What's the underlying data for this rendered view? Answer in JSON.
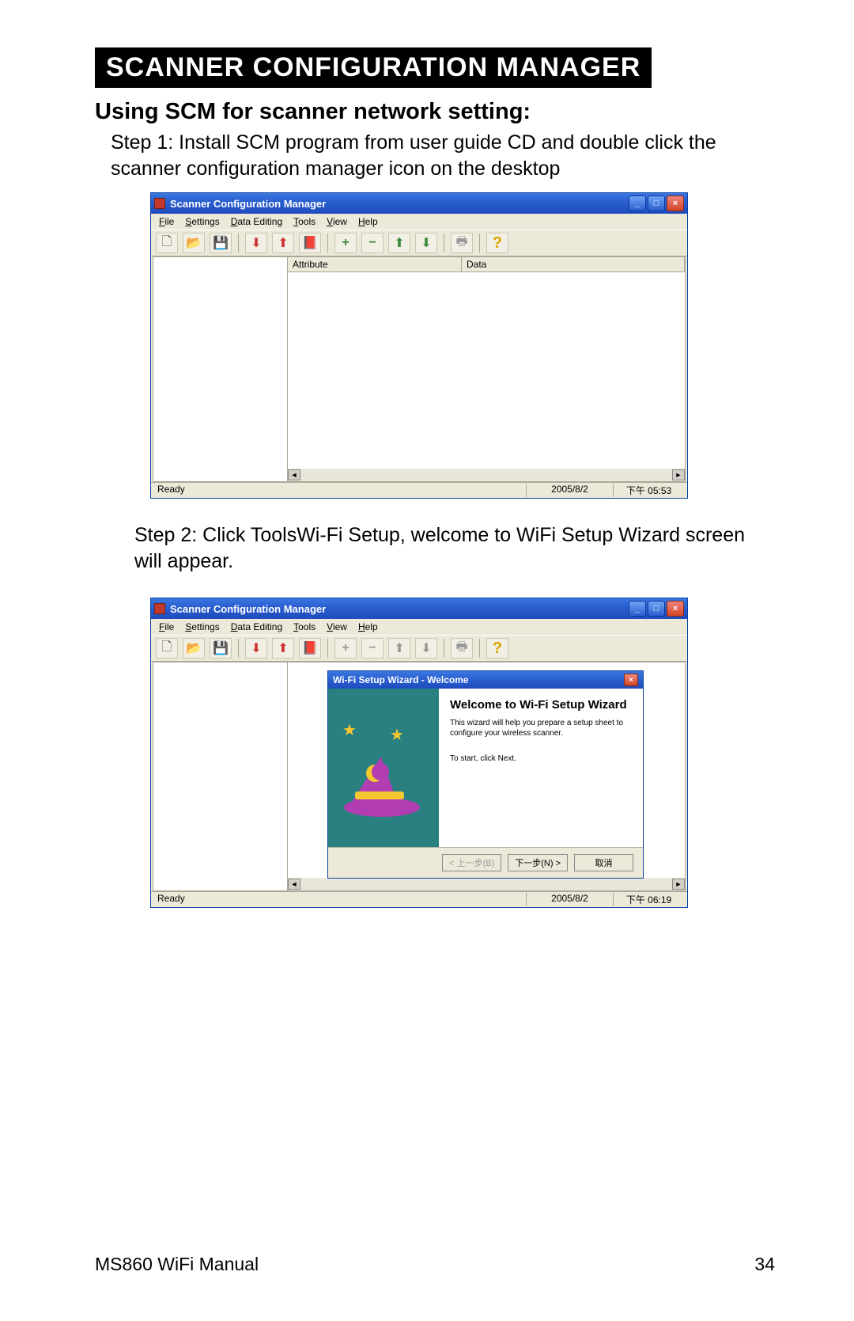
{
  "doc": {
    "page_title": "SCANNER CONFIGURATION MANAGER",
    "subtitle": "Using SCM for scanner network setting:",
    "step1": "Step 1: Install SCM program from user guide CD and double click the scanner configuration manager icon on the desktop",
    "step2": "Step 2: Click ToolsWi-Fi Setup, welcome to WiFi Setup Wizard screen will appear.",
    "footer_title": "MS860 WiFi Manual",
    "footer_page": "34"
  },
  "app": {
    "title": "Scanner Configuration Manager",
    "menus": [
      "File",
      "Settings",
      "Data Editing",
      "Tools",
      "View",
      "Help"
    ],
    "columns": {
      "attribute": "Attribute",
      "data": "Data"
    },
    "status": {
      "ready": "Ready",
      "date1": "2005/8/2",
      "time1": "下午 05:53",
      "date2": "2005/8/2",
      "time2": "下午 06:19"
    }
  },
  "wizard": {
    "title": "Wi-Fi Setup Wizard - Welcome",
    "heading": "Welcome to Wi-Fi Setup Wizard",
    "desc": "This wizard will help you prepare a setup sheet to configure your wireless scanner.",
    "start": "To start, click Next.",
    "buttons": {
      "back": "< 上一步(B)",
      "next": "下一步(N) >",
      "cancel": "取消"
    }
  },
  "winbtn": {
    "min": "_",
    "max": "□",
    "close": "×"
  }
}
